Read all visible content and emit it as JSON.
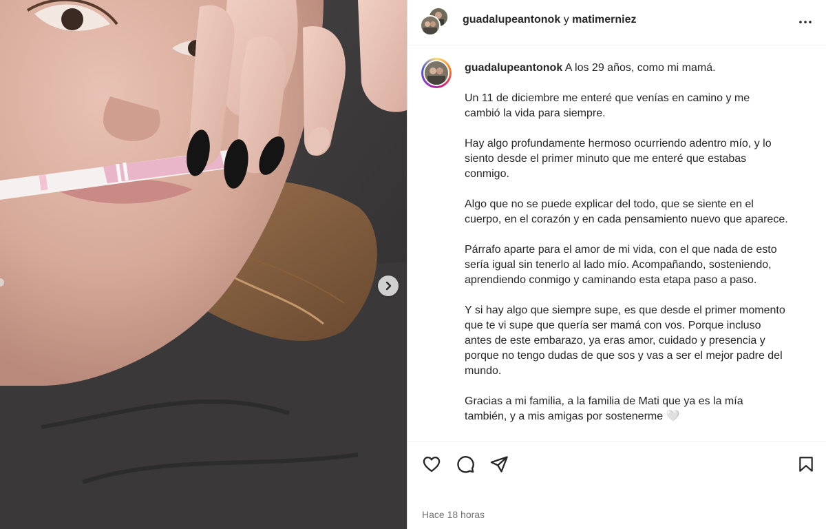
{
  "header": {
    "author": "guadalupeantonok",
    "connector": "y",
    "coauthor": "matimerniez",
    "more_icon": "more-horizontal-icon"
  },
  "caption": {
    "author": "guadalupeantonok",
    "first_line": "A los 29 años, como mi mamá.",
    "paragraphs": [
      "Un 11 de diciembre me enteré que venías en camino y me cambió la vida para siempre.",
      "Hay algo profundamente hermoso ocurriendo adentro mío, y lo siento desde el primer minuto que me enteré que estabas conmigo.",
      "Algo que no se puede explicar del todo, que se siente en el cuerpo, en el corazón y en cada pensamiento nuevo que aparece.",
      "Párrafo aparte para el amor de mi vida, con el que nada de esto sería igual sin tenerlo al lado mío. Acompañando, sosteniendo, aprendiendo conmigo y caminando esta etapa paso a paso.",
      "Y si hay algo que siempre supe, es que desde el primer momento que te vi supe que quería ser mamá con vos. Porque incluso antes de este embarazo, ya eras amor, cuidado y presencia y porque no tengo dudas de que sos y vas a ser el mejor padre del mundo.",
      "Gracias a mi familia, a la familia de Mati que ya es la mía también, y a mis amigas por sostenerme 🤍"
    ]
  },
  "actions": {
    "like_icon": "heart-icon",
    "comment_icon": "comment-icon",
    "share_icon": "send-icon",
    "save_icon": "bookmark-icon"
  },
  "timestamp": "Hace 18 horas",
  "colors": {
    "text": "#262626",
    "muted": "#737373",
    "border": "#efefef"
  }
}
